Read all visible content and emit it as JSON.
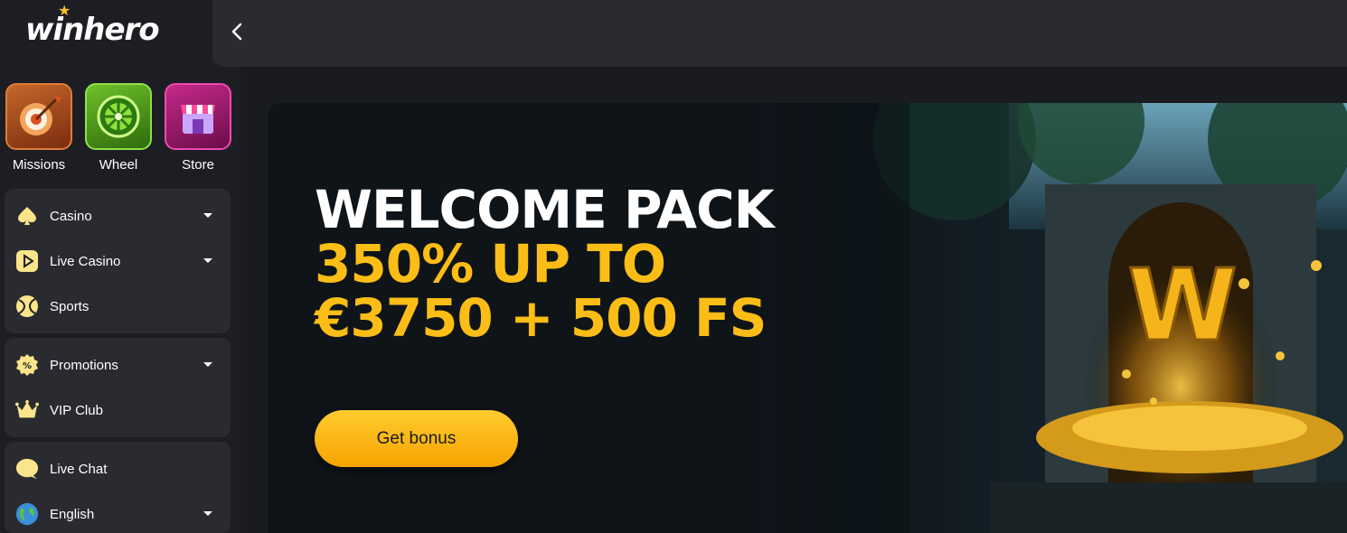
{
  "brand": {
    "name": "winhero",
    "accent": "#fbbd16"
  },
  "quick_links": [
    {
      "label": "Missions",
      "icon": "dart-target-icon"
    },
    {
      "label": "Wheel",
      "icon": "wheel-icon"
    },
    {
      "label": "Store",
      "icon": "store-icon"
    }
  ],
  "nav": {
    "games": [
      {
        "label": "Casino",
        "icon": "spade-icon",
        "expandable": true
      },
      {
        "label": "Live Casino",
        "icon": "play-icon",
        "expandable": true
      },
      {
        "label": "Sports",
        "icon": "ball-icon",
        "expandable": false
      }
    ],
    "rewards": [
      {
        "label": "Promotions",
        "icon": "percent-badge-icon",
        "expandable": true
      },
      {
        "label": "VIP Club",
        "icon": "crown-icon",
        "expandable": false
      }
    ],
    "support": [
      {
        "label": "Live Chat",
        "icon": "chat-bubble-icon",
        "expandable": false
      },
      {
        "label": "English",
        "icon": "globe-icon",
        "expandable": true
      }
    ]
  },
  "topbar": {
    "back_icon": "chevron-left-icon"
  },
  "hero": {
    "title": "WELCOME PACK",
    "offer_line1": "350% UP TO",
    "offer_line2": "€3750 + 500 FS",
    "cta_label": "Get bonus"
  }
}
